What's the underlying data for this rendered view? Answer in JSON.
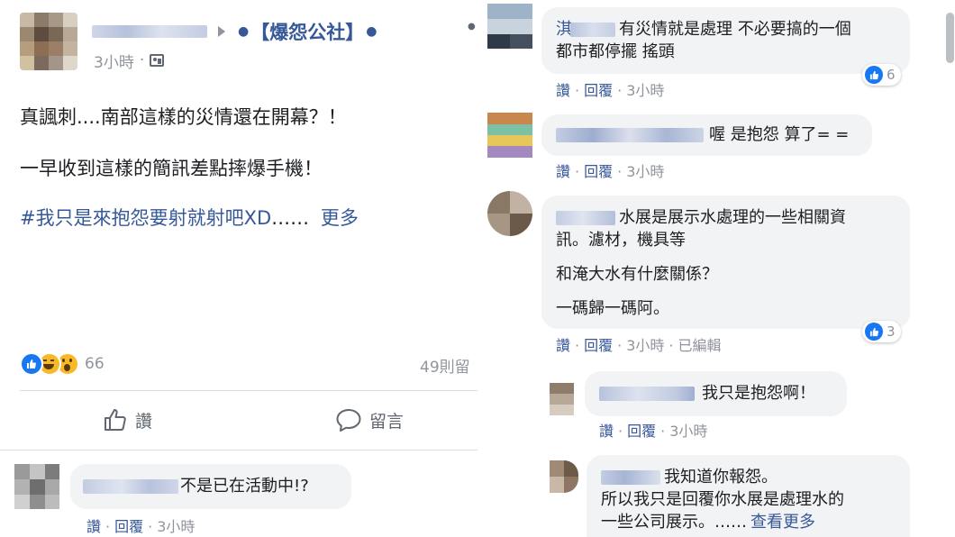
{
  "post": {
    "page_name": "【爆怨公社】",
    "timestamp": "3小時",
    "body_lines": [
      "真諷刺....南部這樣的災情還在開幕？！",
      "一早收到這樣的簡訊差點摔爆手機！"
    ],
    "hashtag": "#我只是來抱怨要射就射吧XD",
    "ellipsis": "……",
    "more_label": "更多",
    "reaction_count": "66",
    "comment_count": "49則留",
    "like_label": "讚",
    "comment_label": "留言"
  },
  "comments": [
    {
      "text": "不是已在活動中!?",
      "like": "讚",
      "reply": "回覆",
      "time": "3小時"
    },
    {
      "name_fragment": "淇",
      "lines": [
        "有災情就是處理 不必要搞的一個",
        "都市都停擺 搖頭"
      ],
      "like": "讚",
      "reply": "回覆",
      "time": "3小時",
      "reactions": "6"
    },
    {
      "lines": [
        "喔 是抱怨 算了= ="
      ],
      "like": "讚",
      "reply": "回覆",
      "time": "3小時"
    },
    {
      "lines": [
        "水展是展示水處理的一些相關資",
        "訊。濾材，機具等",
        "和淹大水有什麼關係？",
        "一碼歸一碼阿。"
      ],
      "like": "讚",
      "reply": "回覆",
      "time": "3小時",
      "edited": "已編輯",
      "reactions": "3"
    },
    {
      "lines": [
        "我只是抱怨啊！"
      ],
      "like": "讚",
      "reply": "回覆",
      "time": "3小時"
    },
    {
      "lines": [
        "我知道你報怨。",
        "所以我只是回覆你水展是處理水的",
        "一些公司展示。……"
      ],
      "more": "查看更多"
    }
  ],
  "colors": {
    "link": "#385898",
    "hashtag": "#365899",
    "meta": "#90949c",
    "bubble": "#f2f3f5",
    "like_blue": "#1877f2"
  },
  "icons": [
    "globe-icon",
    "caret-right-icon",
    "like-outline-icon",
    "comment-outline-icon",
    "like-reaction-icon",
    "haha-reaction-icon",
    "wow-reaction-icon"
  ]
}
